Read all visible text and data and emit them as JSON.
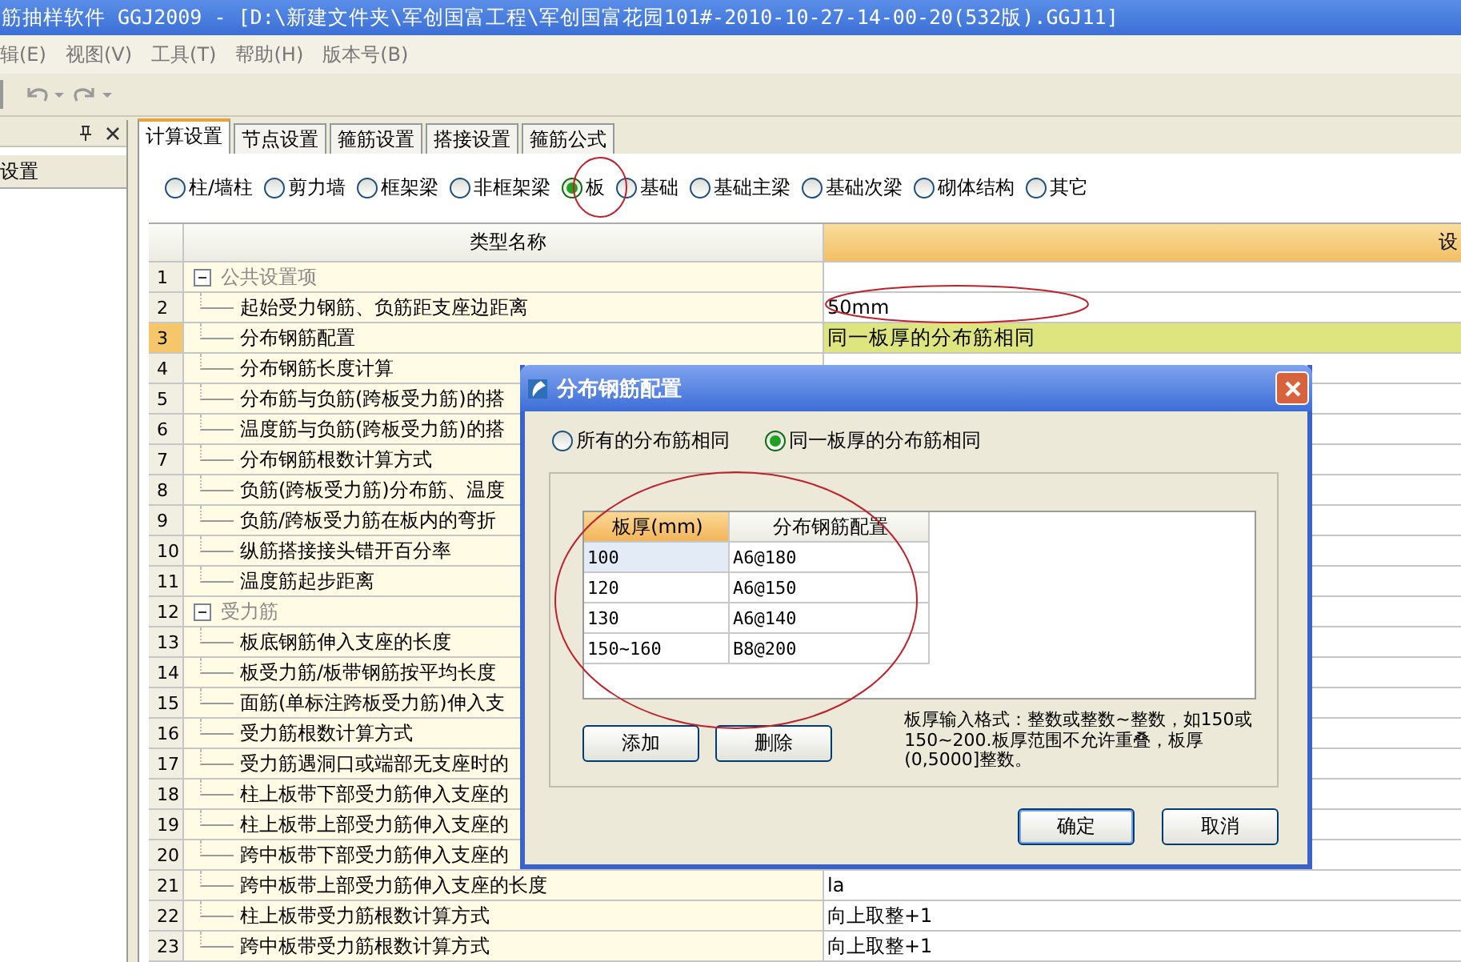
{
  "window": {
    "title": "筋抽样软件 GGJ2009 - [D:\\新建文件夹\\军创国富工程\\军创国富花园101#-2010-10-27-14-00-20(532版).GGJ11]"
  },
  "menu": [
    "辑(E)",
    "视图(V)",
    "工具(T)",
    "帮助(H)",
    "版本号(B)"
  ],
  "left_panel": {
    "items": [
      {
        "label": "设置",
        "selected": false
      }
    ]
  },
  "tabs": [
    {
      "label": "计算设置",
      "selected": true
    },
    {
      "label": "节点设置",
      "selected": false
    },
    {
      "label": "箍筋设置",
      "selected": false
    },
    {
      "label": "搭接设置",
      "selected": false
    },
    {
      "label": "箍筋公式",
      "selected": false
    }
  ],
  "element_types": [
    {
      "label": "柱/墙柱",
      "selected": false
    },
    {
      "label": "剪力墙",
      "selected": false
    },
    {
      "label": "框架梁",
      "selected": false
    },
    {
      "label": "非框架梁",
      "selected": false
    },
    {
      "label": "板",
      "selected": true
    },
    {
      "label": "基础",
      "selected": false
    },
    {
      "label": "基础主梁",
      "selected": false
    },
    {
      "label": "基础次梁",
      "selected": false
    },
    {
      "label": "砌体结构",
      "selected": false
    },
    {
      "label": "其它",
      "selected": false
    }
  ],
  "table": {
    "columns": [
      "类型名称",
      "设"
    ],
    "rows": [
      {
        "number": "1",
        "kind": "group",
        "expanded": true,
        "name": "公共设置项",
        "selected": false
      },
      {
        "number": "2",
        "kind": "item",
        "name": "起始受力钢筋、负筋距支座边距离",
        "value": "50mm",
        "selected": false
      },
      {
        "number": "3",
        "kind": "item",
        "name": "分布钢筋配置",
        "value": "同一板厚的分布筋相同",
        "selected": true
      },
      {
        "number": "4",
        "kind": "item",
        "name": "分布钢筋长度计算",
        "selected": false
      },
      {
        "number": "5",
        "kind": "item",
        "name": "分布筋与负筋(跨板受力筋)的搭",
        "selected": false
      },
      {
        "number": "6",
        "kind": "item",
        "name": "温度筋与负筋(跨板受力筋)的搭",
        "selected": false
      },
      {
        "number": "7",
        "kind": "item",
        "name": "分布钢筋根数计算方式",
        "selected": false
      },
      {
        "number": "8",
        "kind": "item",
        "name": "负筋(跨板受力筋)分布筋、温度",
        "selected": false
      },
      {
        "number": "9",
        "kind": "item",
        "name": "负筋/跨板受力筋在板内的弯折",
        "selected": false
      },
      {
        "number": "10",
        "kind": "item",
        "name": "纵筋搭接接头错开百分率",
        "selected": false
      },
      {
        "number": "11",
        "kind": "item",
        "name": "温度筋起步距离",
        "selected": false
      },
      {
        "number": "12",
        "kind": "group",
        "expanded": true,
        "name": "受力筋",
        "selected": false
      },
      {
        "number": "13",
        "kind": "item",
        "name": "板底钢筋伸入支座的长度",
        "selected": false
      },
      {
        "number": "14",
        "kind": "item",
        "name": "板受力筋/板带钢筋按平均长度",
        "selected": false
      },
      {
        "number": "15",
        "kind": "item",
        "name": "面筋(单标注跨板受力筋)伸入支",
        "selected": false
      },
      {
        "number": "16",
        "kind": "item",
        "name": "受力筋根数计算方式",
        "selected": false
      },
      {
        "number": "17",
        "kind": "item",
        "name": "受力筋遇洞口或端部无支座时的",
        "selected": false
      },
      {
        "number": "18",
        "kind": "item",
        "name": "柱上板带下部受力筋伸入支座的",
        "selected": false
      },
      {
        "number": "19",
        "kind": "item",
        "name": "柱上板带上部受力筋伸入支座的",
        "selected": false
      },
      {
        "number": "20",
        "kind": "item",
        "name": "跨中板带下部受力筋伸入支座的",
        "selected": false
      },
      {
        "number": "21",
        "kind": "item",
        "name": "跨中板带上部受力筋伸入支座的长度",
        "value": "la",
        "selected": false
      },
      {
        "number": "22",
        "kind": "item",
        "name": "柱上板带受力筋根数计算方式",
        "value": "向上取整+1",
        "selected": false
      },
      {
        "number": "23",
        "kind": "item",
        "name": "跨中板带受力筋根数计算方式",
        "value": "向上取整+1",
        "selected": false
      }
    ]
  },
  "dialog": {
    "title": "分布钢筋配置",
    "options": [
      {
        "label": "所有的分布筋相同",
        "selected": false
      },
      {
        "label": "同一板厚的分布筋相同",
        "selected": true
      }
    ],
    "grid": {
      "columns": [
        "板厚(mm)",
        "分布钢筋配置"
      ],
      "rows": [
        {
          "thickness": "100",
          "config": "A6@180",
          "selected": true
        },
        {
          "thickness": "120",
          "config": "A6@150",
          "selected": false
        },
        {
          "thickness": "130",
          "config": "A6@140",
          "selected": false
        },
        {
          "thickness": "150~160",
          "config": "B8@200",
          "selected": false
        }
      ]
    },
    "buttons": [
      "添加",
      "删除"
    ],
    "note": "板厚输入格式：整数或整数~整数，如150或150~200.板厚范围不允许重叠，板厚(0,5000]整数。",
    "actions": [
      "确定",
      "取消"
    ]
  }
}
